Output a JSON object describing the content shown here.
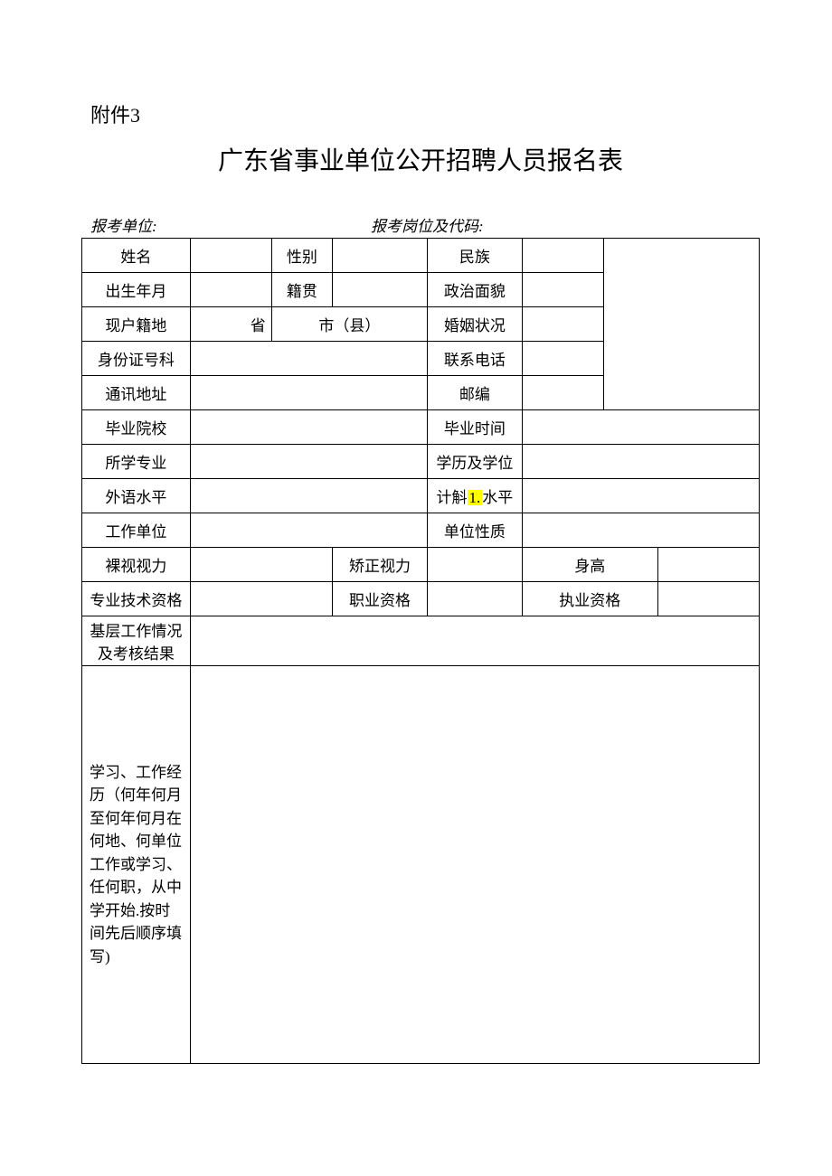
{
  "attachment": "附件3",
  "title": "广东省事业单位公开招聘人员报名表",
  "header": {
    "unit_label": "报考单位:",
    "unit_value": "",
    "position_label": "报考岗位及代码:",
    "position_value": ""
  },
  "rows": {
    "r1": {
      "name_label": "姓名",
      "name_value": "",
      "gender_label": "性别",
      "gender_value": "",
      "ethnicity_label": "民族",
      "ethnicity_value": ""
    },
    "r2": {
      "birth_label": "出生年月",
      "birth_value": "",
      "native_label": "籍贯",
      "native_value": "",
      "political_label": "政治面貌",
      "political_value": ""
    },
    "r3": {
      "huji_label": "现户籍地",
      "province_suffix": "省",
      "city_suffix": "市（县）",
      "marital_label": "婚姻状况",
      "marital_value": ""
    },
    "r4": {
      "id_label": "身份证号科",
      "id_value": "",
      "phone_label": "联系电话",
      "phone_value": ""
    },
    "r5": {
      "addr_label": "通讯地址",
      "addr_value": "",
      "zip_label": "邮编",
      "zip_value": ""
    },
    "r6": {
      "school_label": "毕业院校",
      "school_value": "",
      "gradtime_label": "毕业时间",
      "gradtime_value": ""
    },
    "r7": {
      "major_label": "所学专业",
      "major_value": "",
      "degree_label": "学历及学位",
      "degree_value": ""
    },
    "r8": {
      "foreign_label": "外语水平",
      "foreign_value": "",
      "comp_prefix": "计斛",
      "comp_highlight": "1.",
      "comp_suffix": "水平",
      "comp_value": ""
    },
    "r9": {
      "workunit_label": "工作单位",
      "workunit_value": "",
      "unittype_label": "单位性质",
      "unittype_value": ""
    },
    "r10": {
      "naked_label": "裸视视力",
      "naked_value": "",
      "corrected_label": "矫正视力",
      "corrected_value": "",
      "height_label": "身高",
      "height_value": ""
    },
    "r11": {
      "protech_label": "专业技术资格",
      "protech_value": "",
      "vocation_label": "职业资格",
      "vocation_value": "",
      "practice_label": "执业资格",
      "practice_value": ""
    },
    "r12": {
      "grassroots_label": "基层工作情况及考核结果",
      "grassroots_value": ""
    },
    "r13": {
      "experience_label": "学习、工作经历（何年何月至何年何月在何地、何单位工作或学习、任何职，从中学开始.按时间先后顺序填写)",
      "experience_value": ""
    }
  }
}
